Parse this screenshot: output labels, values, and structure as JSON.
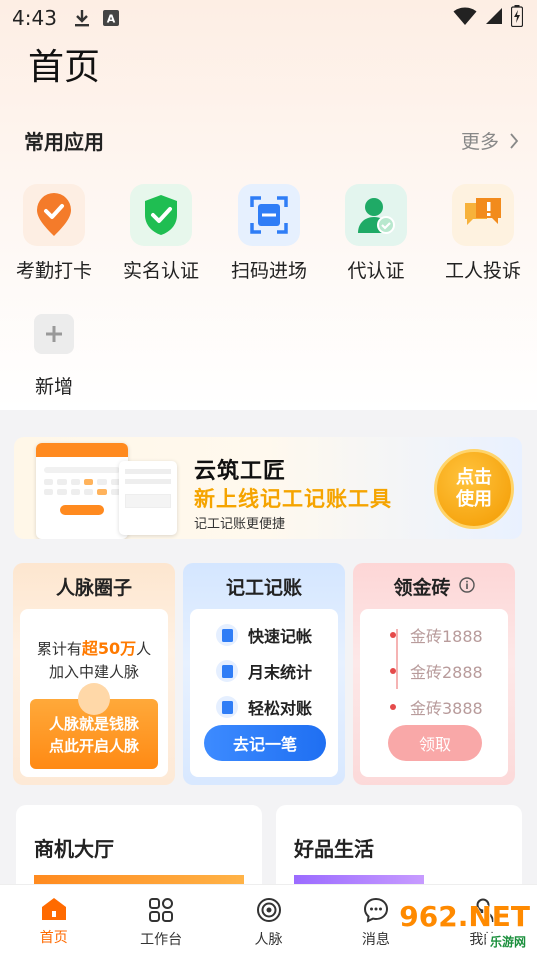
{
  "status_bar": {
    "time": "4:43"
  },
  "page_title": "首页",
  "common_apps": {
    "title": "常用应用",
    "more_label": "更多",
    "items": [
      {
        "label": "考勤打卡",
        "icon": "attendance-check-icon"
      },
      {
        "label": "实名认证",
        "icon": "shield-check-icon"
      },
      {
        "label": "扫码进场",
        "icon": "scan-icon"
      },
      {
        "label": "代认证",
        "icon": "user-verify-icon"
      },
      {
        "label": "工人投诉",
        "icon": "complaint-icon"
      }
    ],
    "add_label": "新增"
  },
  "banner": {
    "title": "云筑工匠",
    "headline": "新上线记工记账工具",
    "subtitle": "记工记账更便捷",
    "button_label": "点击使用"
  },
  "cards": {
    "network": {
      "title": "人脉圈子",
      "line1_prefix": "累计有",
      "line1_highlight": "超50万",
      "line1_suffix": "人",
      "line2": "加入中建人脉",
      "promo_line1": "人脉就是钱脉",
      "promo_line2": "点此开启人脉"
    },
    "bookkeeping": {
      "title": "记工记账",
      "features": [
        "快速记帐",
        "月末统计",
        "轻松对账"
      ],
      "button_label": "去记一笔"
    },
    "gold": {
      "title": "领金砖",
      "info_icon": "info-icon",
      "tiers": [
        "金砖1888",
        "金砖2888",
        "金砖3888"
      ],
      "button_label": "领取"
    }
  },
  "bottom_cards": [
    {
      "title": "商机大厅"
    },
    {
      "title": "好品生活"
    }
  ],
  "tabbar": [
    {
      "label": "首页",
      "icon": "home-icon",
      "active": true
    },
    {
      "label": "工作台",
      "icon": "grid-icon",
      "active": false
    },
    {
      "label": "人脉",
      "icon": "network-icon",
      "active": false
    },
    {
      "label": "消息",
      "icon": "message-icon",
      "active": false
    },
    {
      "label": "我的",
      "icon": "profile-icon",
      "active": false
    }
  ],
  "watermark": {
    "main": "962.NET",
    "sub": "乐游网"
  },
  "colors": {
    "accent": "#ff6a00",
    "gold": "#f5a400",
    "blue": "#2f7df6",
    "green": "#1fbe52"
  }
}
